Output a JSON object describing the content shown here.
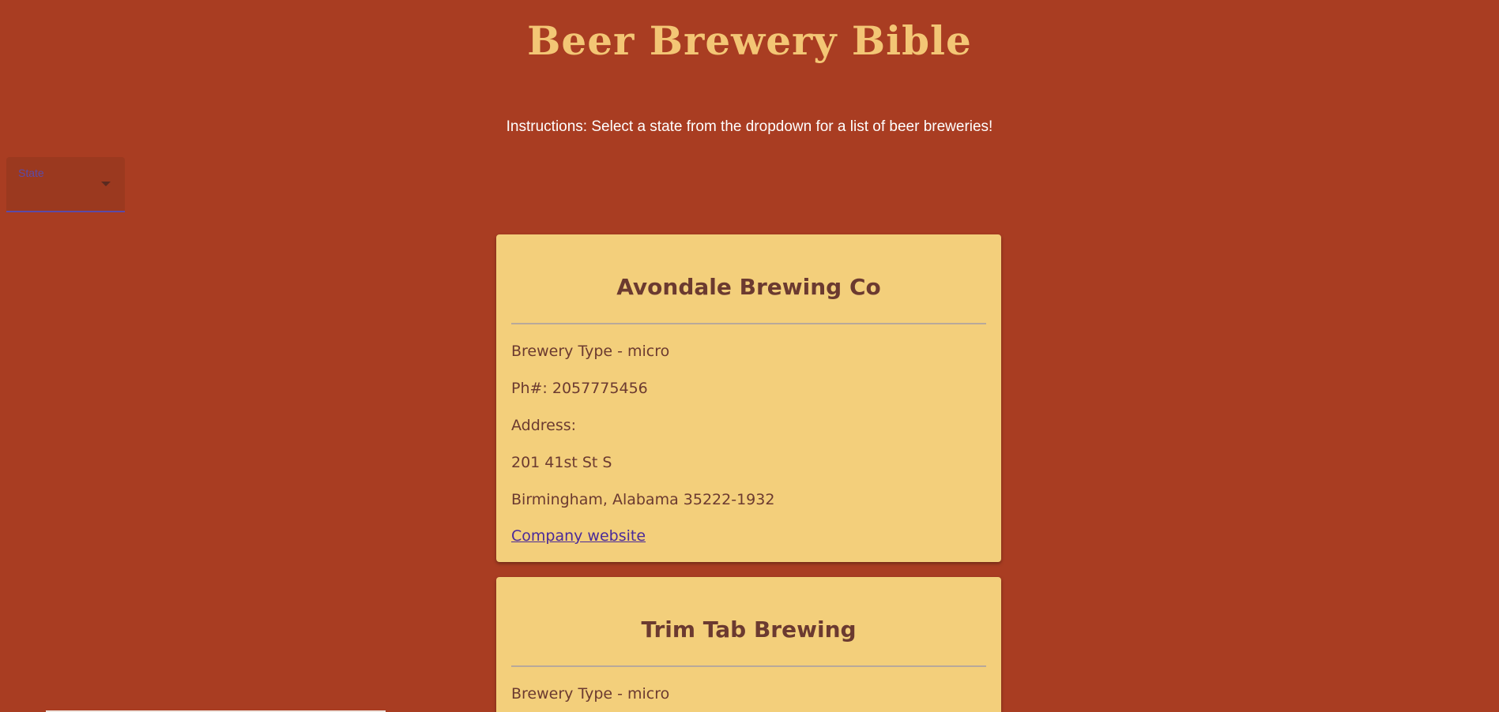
{
  "header": {
    "title": "Beer Brewery Bible",
    "instructions": "Instructions: Select a state from the dropdown for a list of beer breweries!"
  },
  "state_select": {
    "label": "State",
    "value": ""
  },
  "breweries": [
    {
      "name": "Avondale Brewing Co",
      "type_line": "Brewery Type - micro",
      "phone_line": "Ph#: 2057775456",
      "address_label": "Address:",
      "street": "201 41st St S",
      "city_line": "Birmingham, Alabama 35222-1932",
      "website_label": "Company website"
    },
    {
      "name": "Trim Tab Brewing",
      "type_line": "Brewery Type - micro"
    }
  ],
  "colors": {
    "background": "#a93d22",
    "title": "#f3c675",
    "card": "#f3cf7b",
    "card_text": "#6b3a30",
    "link": "#4a2a9a"
  }
}
